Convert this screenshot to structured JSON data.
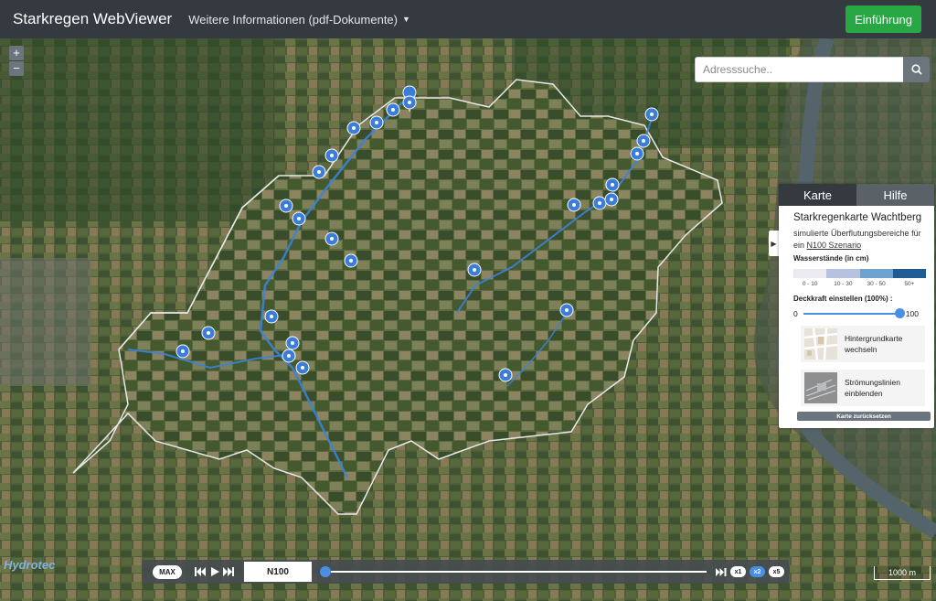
{
  "navbar": {
    "brand": "Starkregen WebViewer",
    "info_menu": "Weitere Informationen (pdf-Dokumente)",
    "intro_button": "Einführung"
  },
  "map": {
    "zoom_in": "+",
    "zoom_out": "−"
  },
  "search": {
    "placeholder": "Adresssuche.."
  },
  "panel": {
    "tabs": [
      {
        "label": "Karte"
      },
      {
        "label": "Hilfe"
      }
    ],
    "title": "Starkregenkarte Wachtberg",
    "subtitle": "simulierte Überflutungsbereiche für ein",
    "scenario_link": "N100 Szenario",
    "legend_title": "Wasserstände (in cm)",
    "legend": [
      {
        "label": "0 - 10",
        "color": "#ece9f3"
      },
      {
        "label": "10 - 30",
        "color": "#b7c2e0"
      },
      {
        "label": "30 - 50",
        "color": "#6fa3cf"
      },
      {
        "label": "50+",
        "color": "#1f5c94"
      }
    ],
    "opacity_label": "Deckkraft einstellen (100%) :",
    "opacity_min": "0",
    "opacity_max": "100",
    "opacity_value": 1.0,
    "options": [
      {
        "label_1": "Hintergrundkarte",
        "label_2": "wechseln"
      },
      {
        "label_1": "Strömungslinien",
        "label_2": "einblenden"
      }
    ],
    "reset_button": "Karte zurücksetzen"
  },
  "timebar": {
    "max_button": "MAX",
    "scenario": "N100",
    "position": 0.0,
    "speeds": [
      {
        "label": "x1",
        "active": false
      },
      {
        "label": "x2",
        "active": true
      },
      {
        "label": "x5",
        "active": false
      }
    ]
  },
  "scale_bar": "1000 m",
  "logo": "Hydrotec",
  "colors": {
    "accent": "#28a745",
    "navbar": "#343a40",
    "marker": "#3b7dd8"
  }
}
